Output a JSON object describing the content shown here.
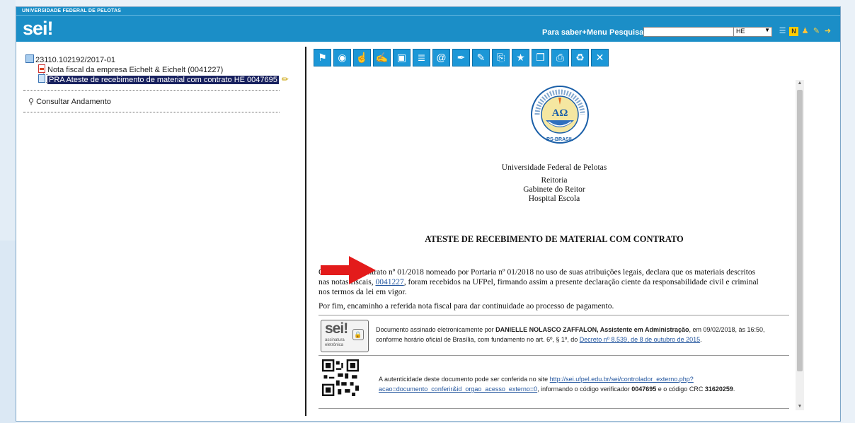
{
  "header": {
    "university": "UNIVERSIDADE FEDERAL DE PELOTAS",
    "logo": "sei!",
    "nav": [
      "Para saber+",
      "Menu",
      "Pesquisa"
    ],
    "search_value": "",
    "unit_selected": "HE",
    "tool_icons": [
      "list-icon",
      "notepad-icon",
      "user-icon",
      "wrench-icon",
      "exit-icon"
    ]
  },
  "tree": {
    "process_number": "23110.102192/2017-01",
    "items": [
      "Nota fiscal da empresa Eichelt & Eichelt (0041227)",
      "PRA Ateste de recebimento de material com contrato HE 0047695"
    ],
    "consult_label": "Consultar Andamento"
  },
  "toolbar_icons": [
    "send-process-icon",
    "view-icon",
    "approve-icon",
    "sign-icon",
    "block-icon",
    "notes-icon",
    "email-icon",
    "pen-icon",
    "edit-icon",
    "attach-icon",
    "include-doc-icon",
    "copy-icon",
    "print-icon",
    "recycle-icon",
    "cancel-icon"
  ],
  "document": {
    "seal_text": "UNIVERSIDADE FEDERAL DE PELOTAS",
    "seal_motto": "RS-BRASIL",
    "institution": "Universidade Federal de Pelotas",
    "dept1": "Reitoria",
    "dept2": "Gabinete do Reitor",
    "dept3": "Hospital Escola",
    "title": "ATESTE DE RECEBIMENTO DE MATERIAL COM CONTRATO",
    "para1_a": "O Fiscal do Contrato nº 01/2018 nomeado por Portaria nº 01/2018 no uso de suas atribuições legais, declara que os materiais descritos",
    "para1_b_pre": "nas notas fiscais, ",
    "para1_link": "0041227",
    "para1_b_post": ", foram recebidos na UFPel, firmando  assim a presente declaração ciente da responsabilidade civil e criminal",
    "para1_c": "nos termos da lei em vigor.",
    "para2": "Por fim, encaminho a referida nota fiscal para dar continuidade ao processo de pagamento.",
    "sig_logo": "sei!",
    "sig_logo_sub1": "assinatura",
    "sig_logo_sub2": "eletrônica",
    "sig_pre": "Documento assinado eletronicamente por ",
    "sig_name": "DANIELLE NOLASCO ZAFFALON, Assistente em Administração",
    "sig_post": ", em 09/02/2018, às 16:50,",
    "sig_line2": "conforme horário oficial de Brasília, com fundamento no art. 6º, § 1º, do ",
    "sig_decree": "Decreto nº 8.539, de 8 de outubro de 2015",
    "sig_end": ".",
    "auth_pre": "A autenticidade deste documento pode ser conferida no site ",
    "auth_link1": "http://sei.ufpel.edu.br/sei/controlador_externo.php?",
    "auth_link2": "acao=documento_conferir&id_orgao_acesso_externo=0",
    "auth_mid": ", informando o código verificador ",
    "auth_code": "0047695",
    "auth_mid2": " e o código CRC ",
    "auth_crc": "31620259",
    "auth_end": "."
  },
  "colors": {
    "topbar": "#1b8ec7",
    "selection": "#18215f",
    "toolbar_icon_bg": "#1c97d7",
    "arrow": "#e31b1b",
    "link": "#22559e"
  }
}
